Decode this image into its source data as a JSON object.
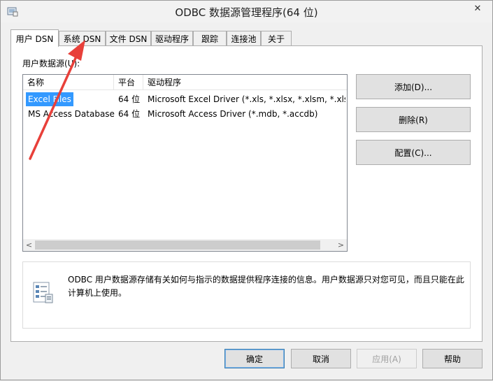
{
  "window": {
    "title": "ODBC 数据源管理程序(64 位)",
    "close_glyph": "✕"
  },
  "tabs": [
    {
      "label": "用户 DSN",
      "active": true
    },
    {
      "label": "系统 DSN"
    },
    {
      "label": "文件 DSN"
    },
    {
      "label": "驱动程序"
    },
    {
      "label": "跟踪"
    },
    {
      "label": "连接池"
    },
    {
      "label": "关于"
    }
  ],
  "panel": {
    "group_label": "用户数据源(U):",
    "columns": [
      "名称",
      "平台",
      "驱动程序"
    ],
    "rows": [
      {
        "name": "Excel Files",
        "platform": "64 位",
        "driver": "Microsoft Excel Driver (*.xls, *.xlsx, *.xlsm, *.xlsb)",
        "selected": true
      },
      {
        "name": "MS Access Database",
        "platform": "64 位",
        "driver": "Microsoft Access Driver (*.mdb, *.accdb)"
      }
    ],
    "scroll_left": "<",
    "scroll_right": ">",
    "side_buttons": {
      "add": "添加(D)...",
      "remove": "删除(R)",
      "configure": "配置(C)..."
    },
    "info_text": "ODBC 用户数据源存储有关如何与指示的数据提供程序连接的信息。用户数据源只对您可见，而且只能在此计算机上使用。"
  },
  "buttons": {
    "ok": "确定",
    "cancel": "取消",
    "apply": "应用(A)",
    "help": "帮助"
  },
  "annotation": {
    "arrow_color": "#e8403a"
  }
}
